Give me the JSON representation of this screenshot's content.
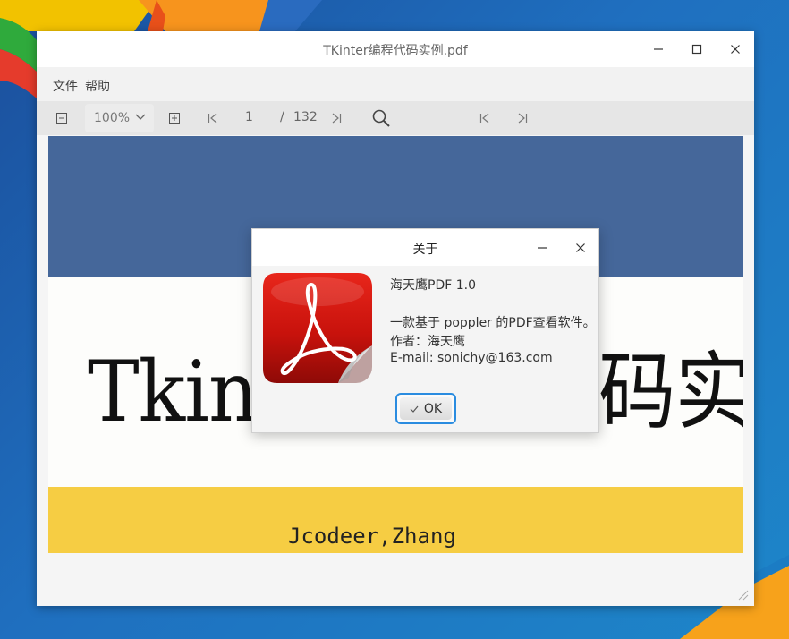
{
  "window": {
    "title": "TKinter编程代码实例.pdf"
  },
  "menu": {
    "items": [
      "文件",
      "帮助"
    ]
  },
  "toolbar": {
    "zoom": "100%",
    "page_current": "1",
    "page_separator": "/",
    "page_total": "132"
  },
  "document": {
    "title_text": "Tkinter编程代码实例",
    "author_text": "Jcodeer,Zhang"
  },
  "about_dialog": {
    "title": "关于",
    "app_name": "海天鹰PDF 1.0",
    "description": "一款基于 poppler 的PDF查看软件。",
    "author": "作者：海天鹰",
    "email": "E-mail: sonichy@163.com",
    "ok_label": "OK"
  },
  "icons": {
    "zoom_out": "zoom-out-icon",
    "zoom_in": "zoom-in-icon",
    "first_page": "first-page-icon",
    "last_page": "last-page-icon",
    "search": "search-icon",
    "app": "acrobat-logo-icon"
  },
  "colors": {
    "accent": "#2a8ce0",
    "page_band_blue": "#45679a",
    "page_band_yellow": "#f6cd43",
    "logo_red": "#c8120c"
  }
}
